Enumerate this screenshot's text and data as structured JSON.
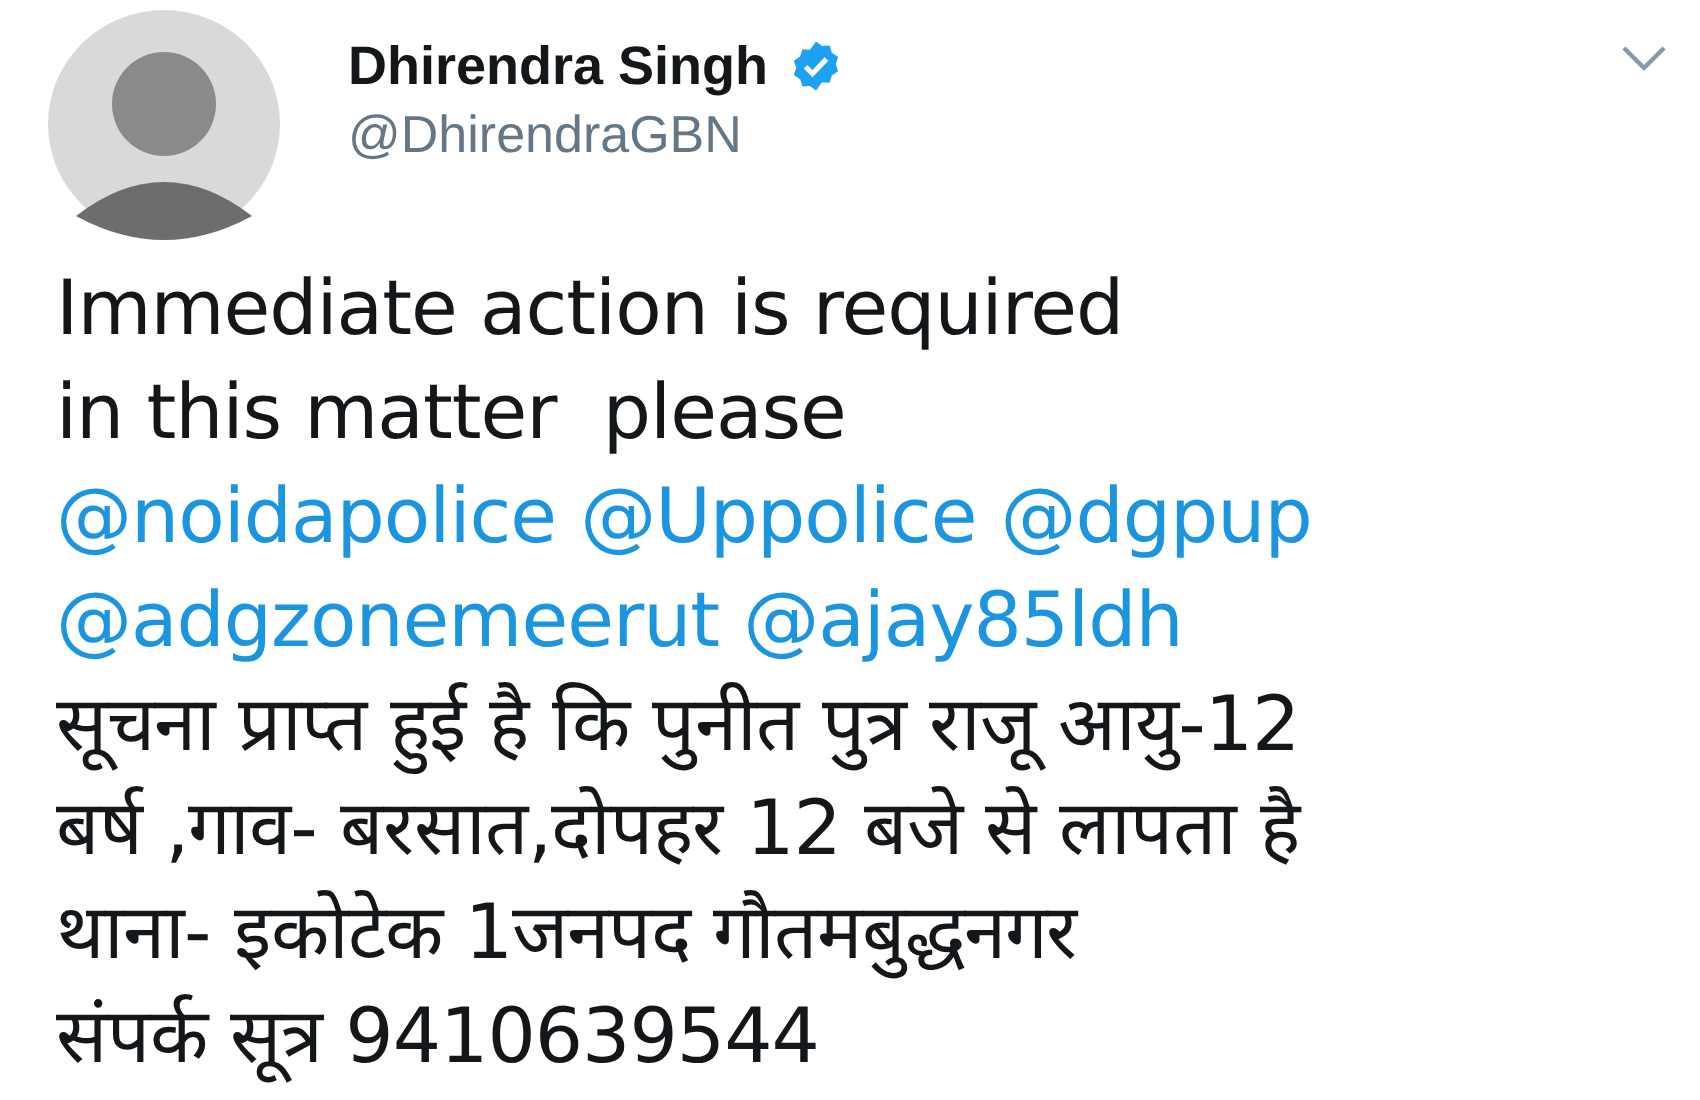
{
  "tweet": {
    "author": {
      "name": "Dhirendra Singh",
      "verified": true,
      "handle": "@DhirendraGBN"
    },
    "lines": [
      {
        "kind": "text",
        "text": "Immediate action is required"
      },
      {
        "kind": "text",
        "text": "in this matter  please"
      },
      {
        "kind": "mentions",
        "mentions": [
          "@noidapolice",
          "@Uppolice",
          "@dgpup"
        ]
      },
      {
        "kind": "mentions",
        "mentions": [
          "@adgzonemeerut",
          "@ajay85ldh"
        ]
      },
      {
        "kind": "text",
        "text": "सूचना प्राप्त हुई है कि पुनीत पुत्र राजू आयु-12"
      },
      {
        "kind": "text",
        "text": "बर्ष ,गाव- बरसात,दोपहर 12 बजे से लापता है"
      },
      {
        "kind": "text",
        "text": "थाना- इकोटेक 1जनपद गौतमबुद्धनगर"
      },
      {
        "kind": "text",
        "text": "संपर्क सूत्र 9410639544"
      }
    ]
  }
}
